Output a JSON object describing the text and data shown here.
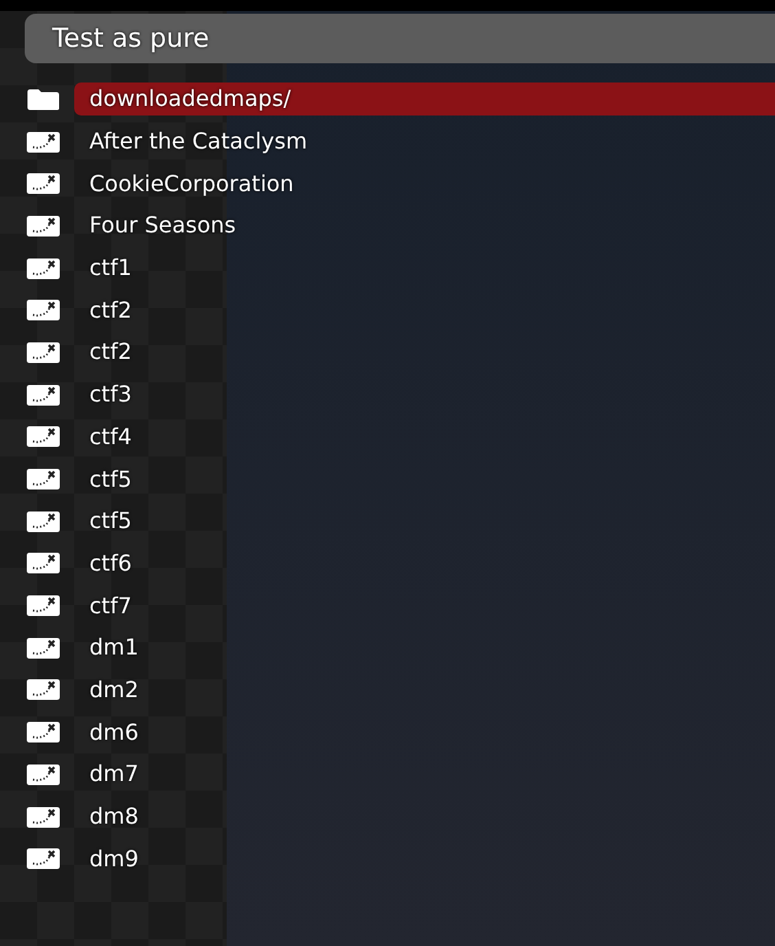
{
  "title": "Test as pure",
  "items": [
    {
      "kind": "folder",
      "name": "downloadedmaps/",
      "selected": true
    },
    {
      "kind": "map",
      "name": "After the Cataclysm",
      "selected": false
    },
    {
      "kind": "map",
      "name": "CookieCorporation",
      "selected": false
    },
    {
      "kind": "map",
      "name": "Four Seasons",
      "selected": false
    },
    {
      "kind": "map",
      "name": "ctf1",
      "selected": false
    },
    {
      "kind": "map",
      "name": "ctf2",
      "selected": false
    },
    {
      "kind": "map",
      "name": "ctf2",
      "selected": false
    },
    {
      "kind": "map",
      "name": "ctf3",
      "selected": false
    },
    {
      "kind": "map",
      "name": "ctf4",
      "selected": false
    },
    {
      "kind": "map",
      "name": "ctf5",
      "selected": false
    },
    {
      "kind": "map",
      "name": "ctf5",
      "selected": false
    },
    {
      "kind": "map",
      "name": "ctf6",
      "selected": false
    },
    {
      "kind": "map",
      "name": "ctf7",
      "selected": false
    },
    {
      "kind": "map",
      "name": "dm1",
      "selected": false
    },
    {
      "kind": "map",
      "name": "dm2",
      "selected": false
    },
    {
      "kind": "map",
      "name": "dm6",
      "selected": false
    },
    {
      "kind": "map",
      "name": "dm7",
      "selected": false
    },
    {
      "kind": "map",
      "name": "dm8",
      "selected": false
    },
    {
      "kind": "map",
      "name": "dm9",
      "selected": false
    }
  ]
}
